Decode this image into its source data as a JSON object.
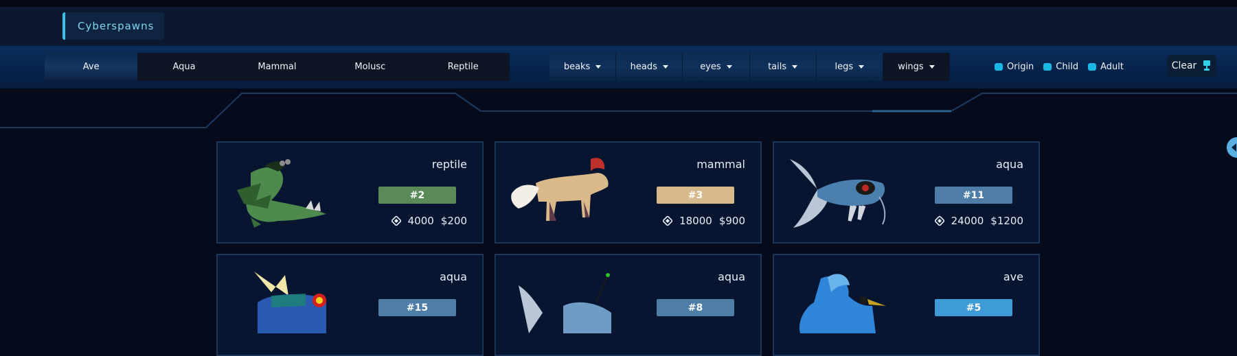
{
  "brand": "Cyberspawns",
  "classes": [
    {
      "label": "Ave",
      "active": true
    },
    {
      "label": "Aqua",
      "active": false
    },
    {
      "label": "Mammal",
      "active": false
    },
    {
      "label": "Molusc",
      "active": false
    },
    {
      "label": "Reptile",
      "active": false
    }
  ],
  "parts": [
    {
      "label": "beaks"
    },
    {
      "label": "heads"
    },
    {
      "label": "eyes"
    },
    {
      "label": "tails"
    },
    {
      "label": "legs"
    },
    {
      "label": "wings"
    }
  ],
  "stages": [
    {
      "label": "Origin"
    },
    {
      "label": "Child"
    },
    {
      "label": "Adult"
    }
  ],
  "clear_label": "Clear",
  "cards": [
    {
      "kind": "reptile",
      "number": "#2",
      "tokens": "4000",
      "usd": "$200",
      "badge_color": "#5a8a58"
    },
    {
      "kind": "mammal",
      "number": "#3",
      "tokens": "18000",
      "usd": "$900",
      "badge_color": "#d6b98a"
    },
    {
      "kind": "aqua",
      "number": "#11",
      "tokens": "24000",
      "usd": "$1200",
      "badge_color": "#4e7ea8"
    },
    {
      "kind": "aqua",
      "number": "#15",
      "tokens": "",
      "usd": "",
      "badge_color": "#4e7ea8"
    },
    {
      "kind": "aqua",
      "number": "#8",
      "tokens": "",
      "usd": "",
      "badge_color": "#4e7ea8"
    },
    {
      "kind": "ave",
      "number": "#5",
      "tokens": "",
      "usd": "",
      "badge_color": "#3f9ad8"
    }
  ]
}
